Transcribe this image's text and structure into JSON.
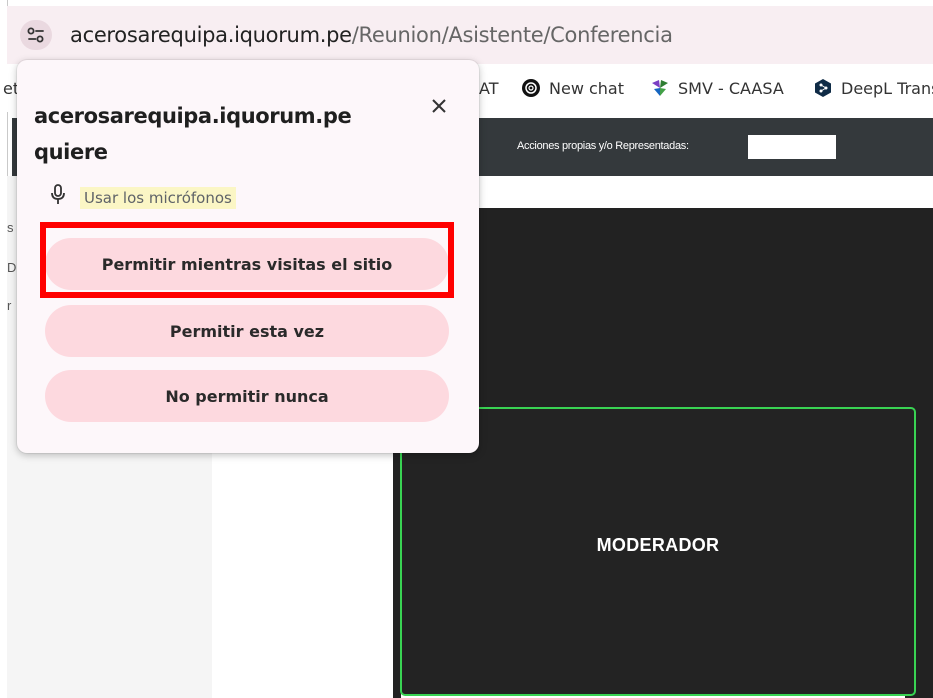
{
  "address_bar": {
    "url_host": "acerosarequipa.iquorum.pe",
    "url_path": "/Reunion/Asistente/Conferencia",
    "site_icon": "tune-icon"
  },
  "bookmarks": [
    {
      "label": "et",
      "icon": ""
    },
    {
      "label": "AT",
      "icon": ""
    },
    {
      "label": "New chat",
      "icon": "openai-icon"
    },
    {
      "label": "SMV - CAASA",
      "icon": "smv-icon"
    },
    {
      "label": "DeepL Trans",
      "icon": "deepl-icon"
    }
  ],
  "page": {
    "header_label": "Acciones propias y/o Representadas:",
    "left_fragments": [
      "s",
      "D",
      "r"
    ],
    "tile_label": "MODERADOR"
  },
  "popup": {
    "title": "acerosarequipa.iquorum.pe quiere",
    "permission_text": "Usar los micrófonos",
    "permission_icon": "microphone-icon",
    "close_icon": "close-icon",
    "buttons": {
      "allow_while_visiting": "Permitir mientras visitas el sitio",
      "allow_once": "Permitir esta vez",
      "never_allow": "No permitir nunca"
    }
  },
  "colors": {
    "popup_bg": "#fdf7fa",
    "button_bg": "#fdd9df",
    "highlight": "#ff0000",
    "tile_border": "#39d353",
    "header_bg": "#34393c",
    "conference_bg": "#222222"
  }
}
